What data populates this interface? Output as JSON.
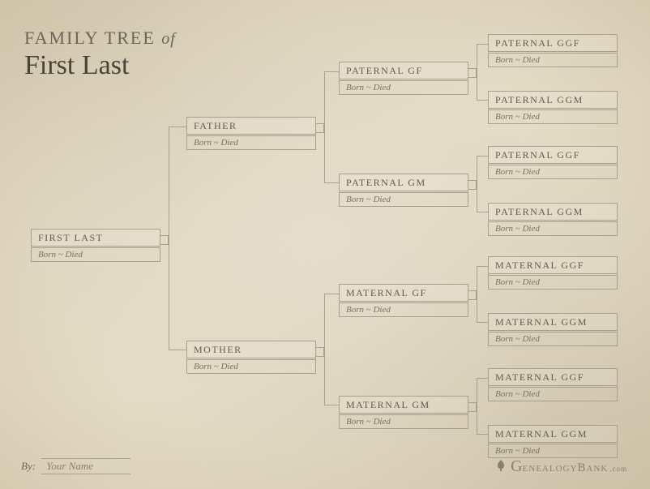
{
  "title": {
    "prefix": "FAMILY TREE",
    "of": "of",
    "name": "First Last"
  },
  "gen1": {
    "name": "FIRST LAST",
    "dates": "Born ~ Died"
  },
  "gen2": {
    "father": {
      "name": "FATHER",
      "dates": "Born ~ Died"
    },
    "mother": {
      "name": "MOTHER",
      "dates": "Born ~ Died"
    }
  },
  "gen3": {
    "pgf": {
      "name": "PATERNAL GF",
      "dates": "Born ~ Died"
    },
    "pgm": {
      "name": "PATERNAL GM",
      "dates": "Born ~ Died"
    },
    "mgf": {
      "name": "MATERNAL GF",
      "dates": "Born ~ Died"
    },
    "mgm": {
      "name": "MATERNAL GM",
      "dates": "Born ~ Died"
    }
  },
  "gen4": {
    "pggf1": {
      "name": "PATERNAL GGF",
      "dates": "Born ~ Died"
    },
    "pggm1": {
      "name": "PATERNAL GGM",
      "dates": "Born ~ Died"
    },
    "pggf2": {
      "name": "PATERNAL GGF",
      "dates": "Born ~ Died"
    },
    "pggm2": {
      "name": "PATERNAL GGM",
      "dates": "Born ~ Died"
    },
    "mggf1": {
      "name": "MATERNAL GGF",
      "dates": "Born ~ Died"
    },
    "mggm1": {
      "name": "MATERNAL GGM",
      "dates": "Born ~ Died"
    },
    "mggf2": {
      "name": "MATERNAL GGF",
      "dates": "Born ~ Died"
    },
    "mggm2": {
      "name": "MATERNAL GGM",
      "dates": "Born ~ Died"
    }
  },
  "byline": {
    "label": "By:",
    "value": "Your Name"
  },
  "brand": {
    "name": "GenealogyBank",
    "tld": ".com"
  }
}
